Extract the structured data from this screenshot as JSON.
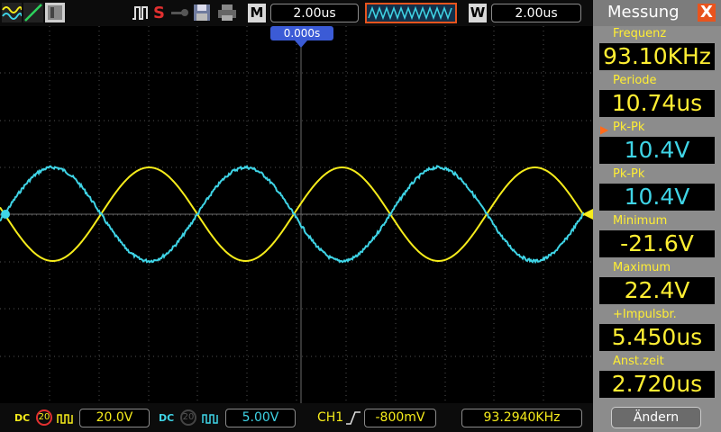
{
  "toolbar": {
    "m_label": "M",
    "timebase": "2.00us",
    "w_label": "W",
    "window_timebase": "2.00us",
    "trigger_position": "0.000s",
    "s_label": "S"
  },
  "bottom": {
    "ch1_coupling": "DC",
    "ch1_bw_limit": "20",
    "ch1_scale": "20.0V",
    "ch2_coupling": "DC",
    "ch2_bw_limit": "20",
    "ch2_scale": "5.00V",
    "trigger_source": "CH1",
    "trigger_level": "-800mV",
    "counter": "93.2940KHz"
  },
  "panel": {
    "title": "Messung",
    "close": "X",
    "measurements": [
      {
        "label": "Frequenz",
        "value": "93.10KHz",
        "color": "#ffee33"
      },
      {
        "label": "Periode",
        "value": "10.74us",
        "color": "#ffee33"
      },
      {
        "label": "Pk-Pk",
        "value": "10.4V",
        "color": "#3fd4e6",
        "selected": true
      },
      {
        "label": "Pk-Pk",
        "value": "10.4V",
        "color": "#3fd4e6"
      },
      {
        "label": "Minimum",
        "value": "-21.6V",
        "color": "#ffee33"
      },
      {
        "label": "Maximum",
        "value": "22.4V",
        "color": "#ffee33"
      },
      {
        "label": "+Impulsbr.",
        "value": "5.450us",
        "color": "#ffee33"
      },
      {
        "label": "Anst.zeit",
        "value": "2.720us",
        "color": "#ffee33"
      }
    ],
    "button": "Ändern"
  },
  "colors": {
    "ch1": "#f6ec1b",
    "ch2": "#3fd4e6",
    "accent": "#e8541e"
  }
}
